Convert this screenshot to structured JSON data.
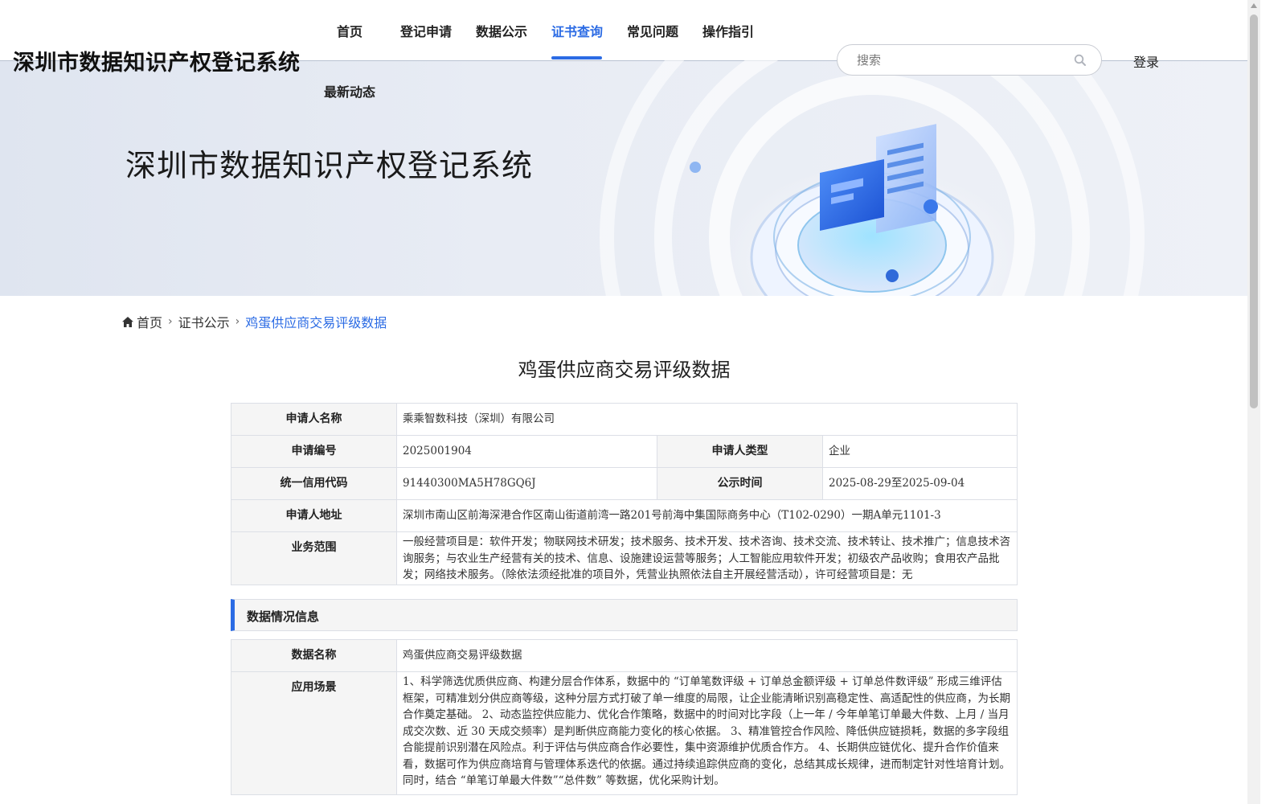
{
  "header": {
    "logo_text": "深圳市数据知识产权登记系统",
    "nav": [
      {
        "label": "首页"
      },
      {
        "label": "登记申请"
      },
      {
        "label": "数据公示"
      },
      {
        "label": "证书查询"
      },
      {
        "label": "常见问题"
      },
      {
        "label": "操作指引"
      },
      {
        "label": "最新动态"
      }
    ],
    "active_nav": "证书查询",
    "search_placeholder": "搜索",
    "login_label": "登录"
  },
  "banner": {
    "title": "深圳市数据知识产权登记系统"
  },
  "breadcrumb": {
    "home": "首页",
    "level2": "证书公示",
    "current": "鸡蛋供应商交易评级数据"
  },
  "page_title": "鸡蛋供应商交易评级数据",
  "applicant": {
    "name_label": "申请人名称",
    "name": "乘乘智数科技（深圳）有限公司",
    "number_label": "申请编号",
    "number": "2025001904",
    "type_label": "申请人类型",
    "type": "企业",
    "credit_code_label": "统一信用代码",
    "credit_code": "91440300MA5H78GQ6J",
    "publicity_label": "公示时间",
    "publicity": "2025-08-29至2025-09-04",
    "address_label": "申请人地址",
    "address": "深圳市南山区前海深港合作区南山街道前湾一路201号前海中集国际商务中心（T102-0290）一期A单元1101-3",
    "scope_label": "业务范围",
    "scope": "一般经营项目是：软件开发；物联网技术研发；技术服务、技术开发、技术咨询、技术交流、技术转让、技术推广；信息技术咨询服务；与农业生产经营有关的技术、信息、设施建设运营等服务；人工智能应用软件开发；初级农产品收购；食用农产品批发；网络技术服务。（除依法须经批准的项目外，凭营业执照依法自主开展经营活动），许可经营项目是：无"
  },
  "data_section": {
    "header": "数据情况信息",
    "data_name_label": "数据名称",
    "data_name": "鸡蛋供应商交易评级数据",
    "scenario_label": "应用场景",
    "scenario": "1、科学筛选优质供应商、构建分层合作体系，数据中的 “订单笔数评级 + 订单总金额评级 + 订单总件数评级” 形成三维评估框架，可精准划分供应商等级，这种分层方式打破了单一维度的局限，让企业能清晰识别高稳定性、高适配性的供应商，为长期合作奠定基础。 2、动态监控供应能力、优化合作策略，数据中的时间对比字段（上一年 / 今年单笔订单最大件数、上月 / 当月成交次数、近 30 天成交频率）是判断供应商能力变化的核心依据。 3、精准管控合作风险、降低供应链损耗，数据的多字段组合能提前识别潜在风险点。利于评估与供应商合作必要性，集中资源维护优质合作方。 4、长期供应链优化、提升合作价值来看，数据可作为供应商培育与管理体系迭代的依据。通过持续追踪供应商的变化，总结其成长规律，进而制定针对性培育计划。同时，结合 “单笔订单最大件数”“总件数” 等数据，优化采购计划。"
  },
  "colors": {
    "accent": "#2b6be4",
    "label_bg": "#f5f5f5",
    "border": "#dcdfe6"
  }
}
